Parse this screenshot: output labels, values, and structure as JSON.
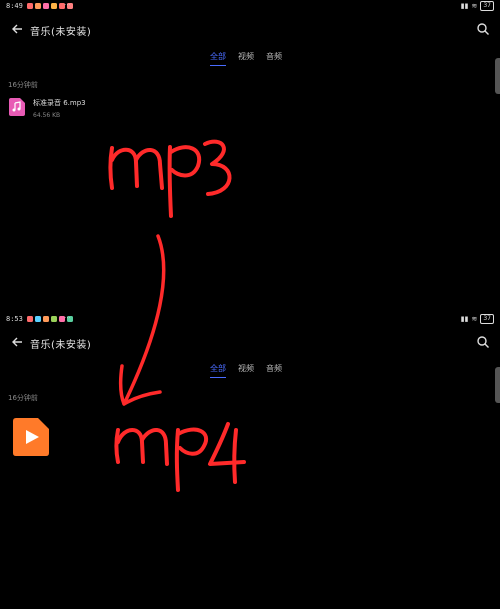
{
  "screen_top": {
    "status": {
      "time": "8:49",
      "more": "···",
      "battery": "37"
    },
    "header": {
      "title": "音乐(未安装)"
    },
    "tabs": [
      {
        "label": "全部",
        "active": true
      },
      {
        "label": "视频",
        "active": false
      },
      {
        "label": "音频",
        "active": false
      }
    ],
    "group_label": "16分钟前",
    "file": {
      "name": "标准录音 6.mp3",
      "meta": "64.56 KB",
      "icon": "music-file-icon"
    }
  },
  "screen_bottom": {
    "status": {
      "time": "8:53",
      "more": "···",
      "battery": "37"
    },
    "header": {
      "title": "音乐(未安装)"
    },
    "tabs": [
      {
        "label": "全部",
        "active": true
      },
      {
        "label": "视频",
        "active": false
      },
      {
        "label": "音频",
        "active": false
      }
    ],
    "group_label": "16分钟前",
    "file": {
      "icon": "video-file-icon"
    }
  },
  "annotations": {
    "top_text": "mp3",
    "bottom_text": "mp4",
    "ink_color": "#ff2a2a"
  },
  "colors": {
    "accent": "#4a6cff",
    "music_icon": "#e85bb5",
    "video_icon": "#ff7a29",
    "background": "#000000"
  }
}
